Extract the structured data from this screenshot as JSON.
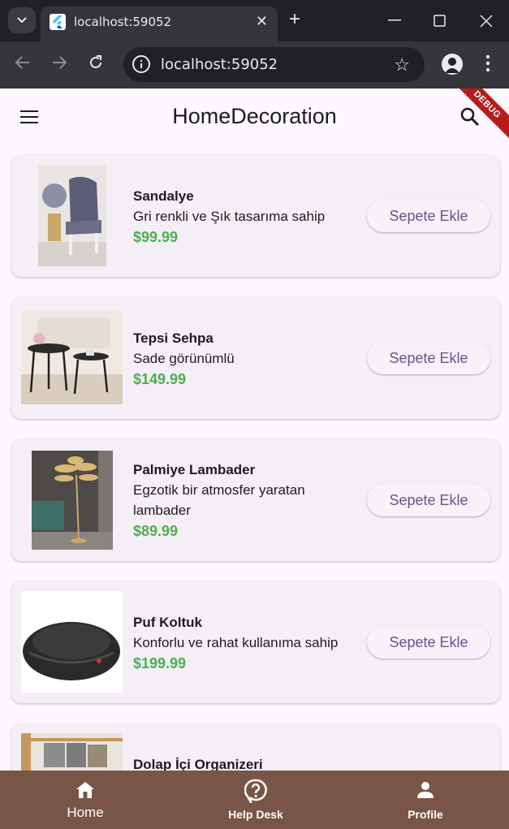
{
  "browser": {
    "tab_title": "localhost:59052",
    "url": "localhost:59052"
  },
  "app": {
    "title": "HomeDecoration",
    "debug_banner": "DEBUG",
    "add_to_cart_label": "Sepete Ekle",
    "products": [
      {
        "name": "Sandalye",
        "description": "Gri renkli ve Şık tasarıma sahip",
        "price": "$99.99"
      },
      {
        "name": "Tepsi Sehpa",
        "description": "Sade görünümlü",
        "price": "$149.99"
      },
      {
        "name": "Palmiye Lambader",
        "description": "Egzotik bir atmosfer yaratan lambader",
        "price": "$89.99"
      },
      {
        "name": "Puf Koltuk",
        "description": "Konforlu ve rahat kullanıma sahip",
        "price": "$199.99"
      },
      {
        "name": "Dolap İçi Organizeri",
        "description": "",
        "price": ""
      }
    ],
    "bottom_nav": [
      {
        "label": "Home",
        "icon": "home-icon",
        "active": true
      },
      {
        "label": "Help Desk",
        "icon": "help-icon",
        "active": false
      },
      {
        "label": "Profile",
        "icon": "person-icon",
        "active": false
      }
    ],
    "colors": {
      "background": "#fdf7ff",
      "card": "#f4eff6",
      "price": "#4caf50",
      "button_text": "#65558f",
      "bottom_nav": "#795548",
      "debug": "#b71c1c"
    }
  }
}
